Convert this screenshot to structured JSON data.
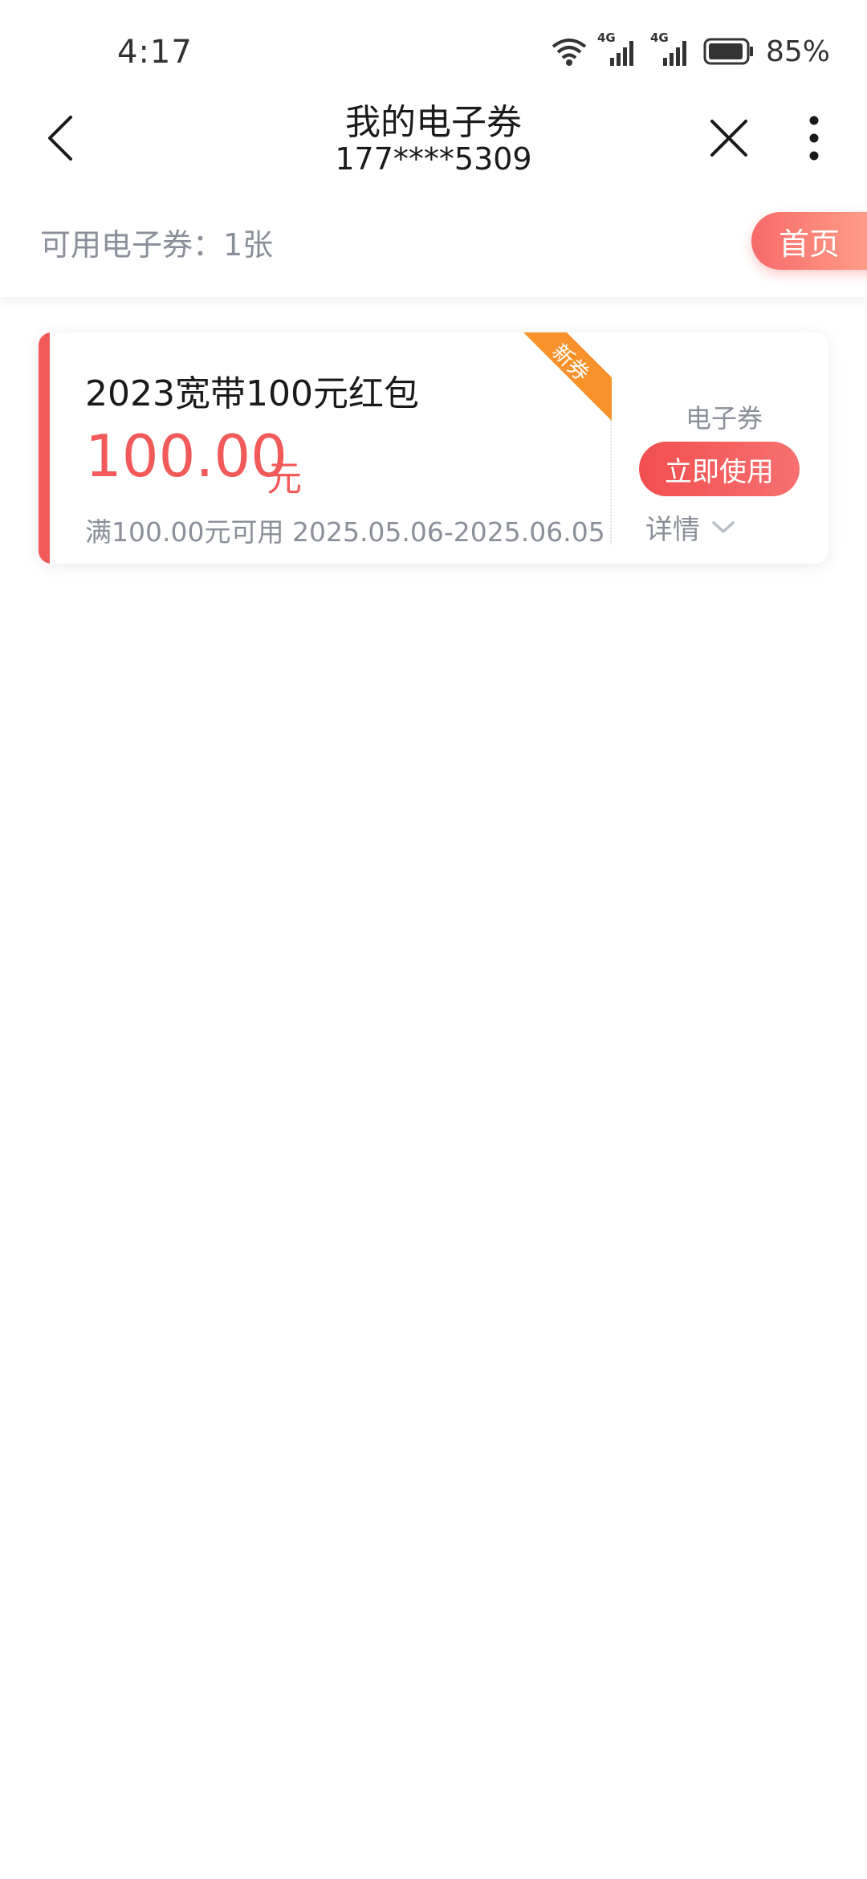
{
  "status_bar": {
    "time": "4:17",
    "network_1": "4G",
    "network_2": "4G",
    "battery_percent": "85%"
  },
  "header": {
    "title": "我的电子券",
    "subtitle": "177****5309"
  },
  "summary": {
    "label": "可用电子券：1张",
    "home_button": "首页"
  },
  "coupon": {
    "name": "2023宽带100元红包",
    "amount": "100.00",
    "unit": "元",
    "description": "满100.00元可用 2025.05.06-2025.06.05",
    "badge": "新券",
    "type_label": "电子券",
    "use_button": "立即使用",
    "details_link": "详情"
  },
  "colors": {
    "accent_red": "#f25a5a",
    "badge_orange": "#f7922b",
    "muted_text": "#8a8f99"
  },
  "icons": {
    "back": "chevron-left-icon",
    "close": "close-icon",
    "more": "more-vertical-icon",
    "details": "chevron-down-icon"
  }
}
